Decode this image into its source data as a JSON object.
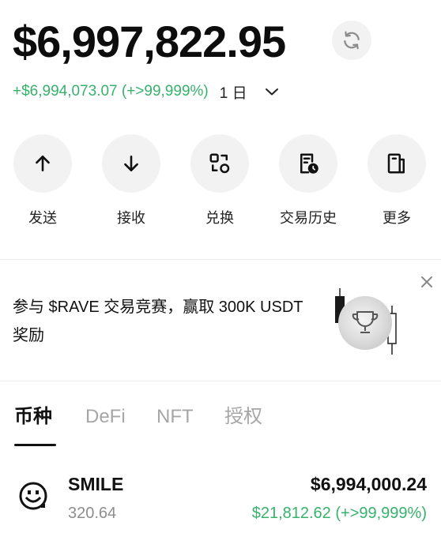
{
  "balance": {
    "total": "$6,997,822.95",
    "change": "+$6,994,073.07 (+>99,999%)",
    "period": "1 日"
  },
  "actions": [
    {
      "label": "发送",
      "icon": "arrow-up-icon"
    },
    {
      "label": "接收",
      "icon": "arrow-down-icon"
    },
    {
      "label": "兑换",
      "icon": "swap-icon"
    },
    {
      "label": "交易历史",
      "icon": "history-icon"
    },
    {
      "label": "更多",
      "icon": "more-icon"
    }
  ],
  "banner": {
    "text": "参与 $RAVE 交易竞赛，赢取 300K USDT 奖励"
  },
  "tabs": [
    {
      "label": "币种",
      "active": true
    },
    {
      "label": "DeFi",
      "active": false
    },
    {
      "label": "NFT",
      "active": false
    },
    {
      "label": "授权",
      "active": false
    }
  ],
  "assets": [
    {
      "name": "SMILE",
      "quantity": "320.64",
      "value": "$6,994,000.24",
      "change": "$21,812.62 (+>99,999%)",
      "icon": "smile-token-icon"
    }
  ],
  "colors": {
    "positive": "#36b26c",
    "button_bg": "#f2f2f2",
    "text": "#111111",
    "muted": "#a6a6a6"
  }
}
